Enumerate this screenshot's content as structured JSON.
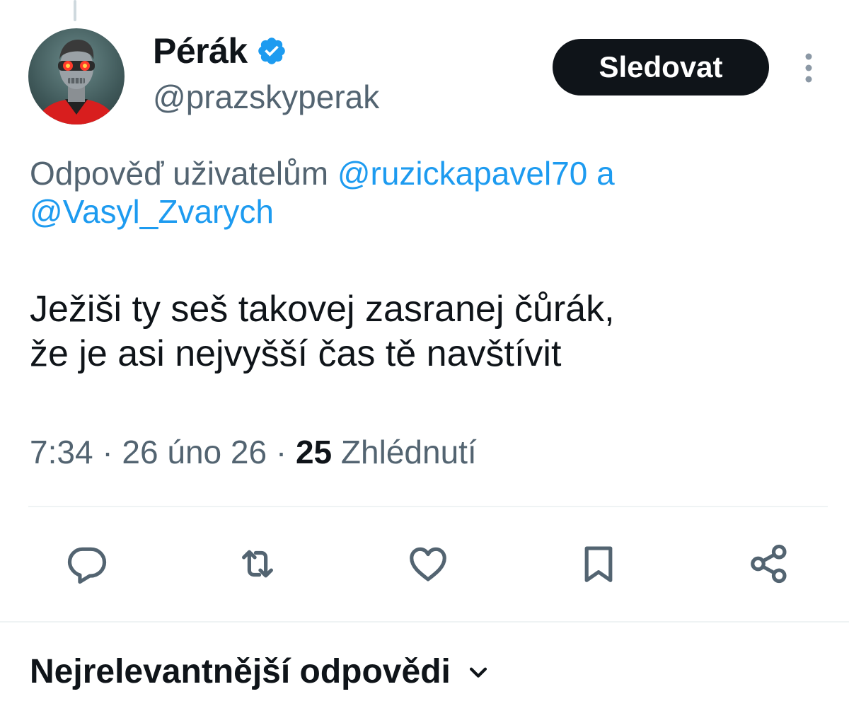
{
  "author": {
    "display_name": "Pérák",
    "handle": "@prazskyperak",
    "verified": true,
    "avatar": "cyborg-portrait-avatar"
  },
  "follow_button": {
    "label": "Sledovat"
  },
  "reply_context": {
    "prefix": "Odpověď uživatelům",
    "mention_1": "@ruzickapavel70",
    "joiner": "a",
    "mention_2": "@Vasyl_Zvarych"
  },
  "tweet": {
    "text": "Ježiši ty seš takovej zasranej čůrák,\nže je asi nejvyšší čas tě navštívit",
    "time": "7:34",
    "separator": "·",
    "date": "26 úno 26",
    "views_count": "25",
    "views_label": "Zhlédnutí"
  },
  "actions": {
    "items": [
      {
        "name": "reply",
        "icon": "speech-bubble-icon"
      },
      {
        "name": "retweet",
        "icon": "retweet-arrows-icon"
      },
      {
        "name": "like",
        "icon": "heart-icon"
      },
      {
        "name": "bookmark",
        "icon": "bookmark-icon"
      },
      {
        "name": "share",
        "icon": "share-icon"
      }
    ]
  },
  "replies_sort": {
    "label": "Nejrelevantnější odpovědi",
    "icon": "chevron-down-icon"
  },
  "colors": {
    "accent": "#1d9bf0",
    "text_primary": "#0f1419",
    "text_secondary": "#536471",
    "follow_button_bg": "#0f1419",
    "divider": "#eff3f4"
  }
}
